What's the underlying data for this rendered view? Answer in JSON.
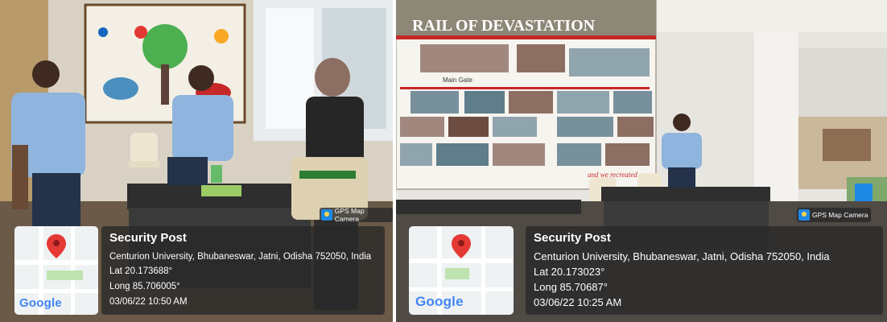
{
  "photos": [
    {
      "camera_badge": "GPS Map Camera",
      "map_logo": "Google",
      "title": "Security Post",
      "address": "Centurion University, Bhubaneswar, Jatni, Odisha 752050, India",
      "lat": "Lat 20.173688°",
      "long": "Long 85.706005°",
      "datetime": "03/06/22 10:50 AM"
    },
    {
      "camera_badge": "GPS Map Camera",
      "map_logo": "Google",
      "title": "Security Post",
      "address": "Centurion University, Bhubaneswar, Jatni, Odisha 752050, India",
      "lat": "Lat 20.173023°",
      "long": "Long 85.70687°",
      "datetime": "03/06/22 10:25 AM"
    }
  ],
  "mural_text": {
    "banner": "RAIL OF DEVASTATION",
    "main_gate": "Main Gate",
    "footer": "and we recreated"
  },
  "colors": {
    "overlay": "#282828",
    "pin": "#e53935",
    "uniform": "#8fb4dd"
  }
}
